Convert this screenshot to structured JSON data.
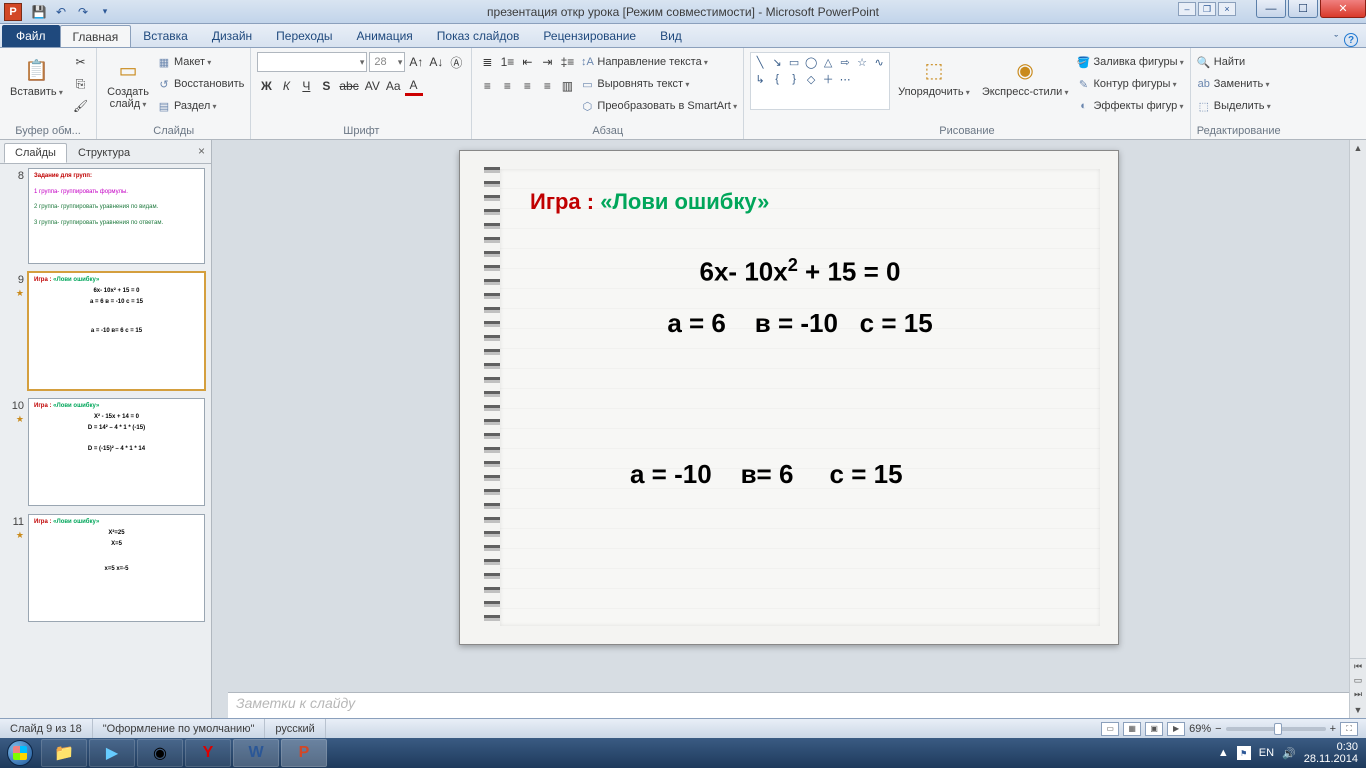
{
  "title": "презентация откр урока [Режим совместимости]  -  Microsoft PowerPoint",
  "tabs": {
    "file": "Файл",
    "home": "Главная",
    "insert": "Вставка",
    "design": "Дизайн",
    "transitions": "Переходы",
    "animations": "Анимация",
    "slideshow": "Показ слайдов",
    "review": "Рецензирование",
    "view": "Вид"
  },
  "ribbon": {
    "clipboard": {
      "paste": "Вставить",
      "label": "Буфер обм..."
    },
    "slides": {
      "new": "Создать\nслайд",
      "layout": "Макет",
      "reset": "Восстановить",
      "section": "Раздел",
      "label": "Слайды"
    },
    "font": {
      "size": "28",
      "label": "Шрифт"
    },
    "para": {
      "textdir": "Направление текста",
      "align": "Выровнять текст",
      "smartart": "Преобразовать в SmartArt",
      "label": "Абзац"
    },
    "draw": {
      "arrange": "Упорядочить",
      "styles": "Экспресс-стили",
      "fill": "Заливка фигуры",
      "outline": "Контур фигуры",
      "effects": "Эффекты фигур",
      "label": "Рисование"
    },
    "edit": {
      "find": "Найти",
      "replace": "Заменить",
      "select": "Выделить",
      "label": "Редактирование"
    }
  },
  "pane": {
    "tab1": "Слайды",
    "tab2": "Структура"
  },
  "thumbs": {
    "n8": "8",
    "t8a": "Задание для групп:",
    "t8b": "1 группа- группировать формулы.",
    "t8c": "2 группа- группировать уравнения по видам.",
    "t8d": "3 группа- группировать уравнения по ответам.",
    "n9": "9",
    "t9a": "Игра :",
    "t9b": "«Лови ошибку»",
    "t9c": "6x- 10x² + 15 = 0",
    "t9d": "a = 6    в = -10   c = 15",
    "t9e": "a = -10   в= 6    c = 15",
    "n10": "10",
    "t10a": "Игра :",
    "t10b": "«Лови ошибку»",
    "t10c": "X² - 15x + 14 = 0",
    "t10d": "D = 14² – 4 * 1 * (-15)",
    "t10e": "D = (-15)² – 4 * 1 * 14",
    "n11": "11",
    "t11a": "Игра :",
    "t11b": "«Лови ошибку»",
    "t11c": "X²=25",
    "t11d": "X=5",
    "t11e": "x=5  x=-5"
  },
  "slide": {
    "title_a": "Игра :  ",
    "title_b": "«Лови ошибку»",
    "line1_a": "6x- 10x",
    "line1_b": "2",
    "line1_c": " + 15 = 0",
    "line2": "a = 6    в = -10   c = 15",
    "line3": "a = -10    в= 6     c = 15"
  },
  "notes": "Заметки к слайду",
  "status": {
    "slide": "Слайд 9 из 18",
    "theme": "\"Оформление по умолчанию\"",
    "lang": "русский",
    "zoom": "69%"
  },
  "tray": {
    "lang": "EN",
    "time": "0:30",
    "date": "28.11.2014"
  }
}
